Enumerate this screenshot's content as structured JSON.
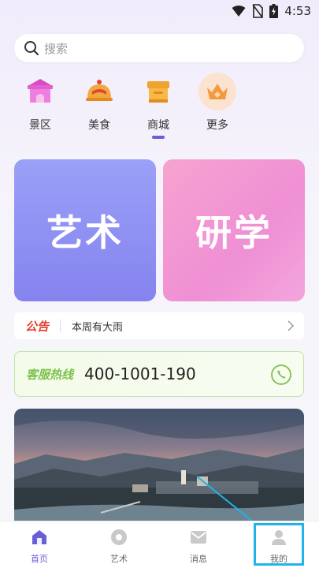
{
  "status_bar": {
    "time": "4:53"
  },
  "search": {
    "placeholder": "搜索"
  },
  "categories": [
    {
      "label": "景区",
      "icon": "scenic-gate-icon"
    },
    {
      "label": "美食",
      "icon": "food-cloche-icon"
    },
    {
      "label": "商城",
      "icon": "store-box-icon"
    },
    {
      "label": "更多",
      "icon": "crown-icon"
    }
  ],
  "tiles": {
    "art": "艺术",
    "study": "研学"
  },
  "notice": {
    "tag": "公告",
    "text": "本周有大雨"
  },
  "hotline": {
    "label": "客服热线",
    "number": "400-1001-190"
  },
  "tabbar": [
    {
      "label": "首页",
      "icon": "home-icon",
      "active": true
    },
    {
      "label": "艺术",
      "icon": "art-icon",
      "active": false
    },
    {
      "label": "消息",
      "icon": "message-icon",
      "active": false
    },
    {
      "label": "我的",
      "icon": "profile-icon",
      "active": false
    }
  ],
  "colors": {
    "accent": "#6b5fd6",
    "notice_red": "#e23b2e",
    "hotline_green": "#7bc24a",
    "highlight": "#1fb3e8"
  }
}
